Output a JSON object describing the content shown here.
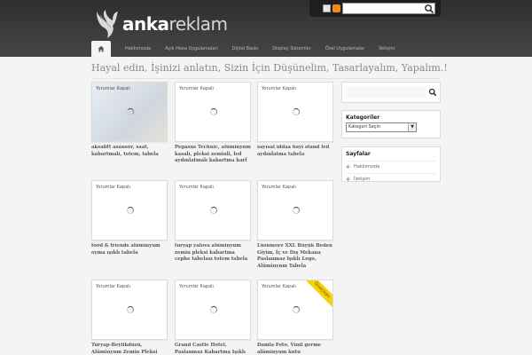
{
  "header": {
    "logo_part1": "anka",
    "logo_part2": "reklam",
    "search_placeholder": ""
  },
  "nav": {
    "items": [
      "Hakkımızda",
      "Açık Hava Uygulamaları",
      "Dijital Baskı",
      "Display Sistemler",
      "Özel Uygulamalar",
      "İletişim"
    ]
  },
  "tagline": "Hayal edin, İşinizi anlatın, Sizin İçin Düşünelim, Tasarlayalım, Yapalım.!",
  "posts": [
    {
      "label": "Yorumlar Kapalı",
      "title": "aksalift asansör, saat, kabartmalı, totem, tabela"
    },
    {
      "label": "Yorumlar Kapalı",
      "title": "Pegasus Technic, alüminyum kasalı, pleksi zeminli, led aydınlatmalı kabartma harf"
    },
    {
      "label": "Yorumlar Kapalı",
      "title": "sayısal iddaa bayi stand led aydınlatma tabela"
    },
    {
      "label": "Yorumlar Kapalı",
      "title": "food & friends alüminyum oyma ışıklı tabela"
    },
    {
      "label": "Yorumlar Kapalı",
      "title": "turyap yalova alüminyum zemin pleksi kabartma cephe tabelası totem tabela"
    },
    {
      "label": "Yorumlar Kapalı",
      "title": "Lüsumore XXL Büyük Beden Giyim, İç ve Dış Mekana Paslanmaz Işıklı Logo, Alüminyum Tabela"
    },
    {
      "label": "Yorumlar Kapalı",
      "title": "Turyap-Beylikdüzü, Alüminyum Zemin Pleksi"
    },
    {
      "label": "Yorumlar Kapalı",
      "title": "Grand Castle Hotel, Paslanmaz Kabartma Işıklı"
    },
    {
      "label": "Yorumlar Kapalı",
      "title": "Damla Foto, Vinil germe alüminyum kutu",
      "badge": "Öneçıkan"
    }
  ],
  "sidebar": {
    "categories_title": "Kategoriler",
    "category_select": "Kategori Seçin",
    "pages_title": "Sayfalar",
    "pages": [
      "Hakkımızda",
      "İletişim"
    ]
  },
  "colors": {
    "header_bg": "#3a3a3a",
    "page_bg": "#f4f4f4",
    "badge": "#f5d20a",
    "rss": "#f08a24"
  }
}
